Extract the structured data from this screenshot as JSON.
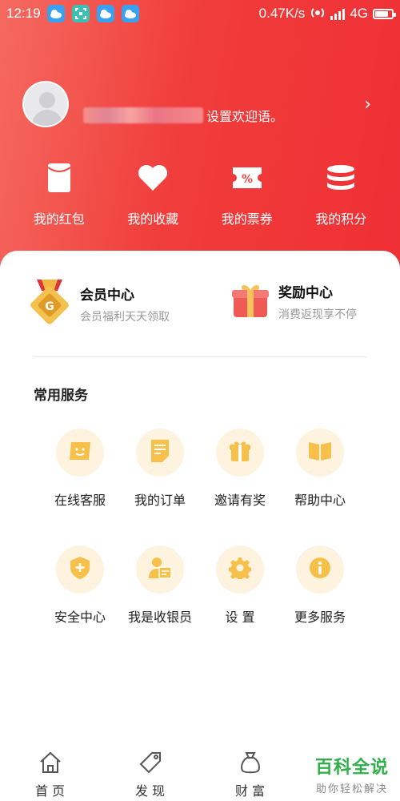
{
  "status_bar": {
    "time": "12:19",
    "network_speed": "0.47K/s",
    "network_type": "4G",
    "icons": [
      "weather-icon",
      "scan-icon",
      "weather-icon",
      "weather-icon",
      "hotspot-icon",
      "signal-icon",
      "battery-icon"
    ]
  },
  "profile": {
    "welcome_suffix": "设置欢迎语。"
  },
  "quick_actions": [
    {
      "label": "我的红包",
      "icon": "red-packet-icon"
    },
    {
      "label": "我的收藏",
      "icon": "heart-icon"
    },
    {
      "label": "我的票券",
      "icon": "coupon-icon"
    },
    {
      "label": "我的积分",
      "icon": "coins-icon"
    }
  ],
  "member_center": {
    "title": "会员中心",
    "subtitle": "会员福利天天领取"
  },
  "reward_center": {
    "title": "奖励中心",
    "subtitle": "消费返现享不停"
  },
  "services": {
    "title": "常用服务",
    "items": [
      {
        "label": "在线客服",
        "icon": "chat-icon"
      },
      {
        "label": "我的订单",
        "icon": "order-icon"
      },
      {
        "label": "邀请有奖",
        "icon": "gift-icon"
      },
      {
        "label": "帮助中心",
        "icon": "book-icon"
      },
      {
        "label": "安全中心",
        "icon": "shield-icon"
      },
      {
        "label": "我是收银员",
        "icon": "cashier-icon"
      },
      {
        "label": "设 置",
        "icon": "gear-icon"
      },
      {
        "label": "更多服务",
        "icon": "info-icon"
      }
    ]
  },
  "bottom_nav": [
    {
      "label": "首 页",
      "icon": "home-icon"
    },
    {
      "label": "发 现",
      "icon": "tag-icon"
    },
    {
      "label": "财 富",
      "icon": "money-bag-icon"
    }
  ],
  "watermark": {
    "title": "百科全说",
    "subtitle": "助你轻松解决"
  },
  "colors": {
    "brand_red": "#ef3336",
    "service_icon": "#f7c04a",
    "service_bg": "#fdf3df",
    "watermark_green": "#2fae4a"
  }
}
